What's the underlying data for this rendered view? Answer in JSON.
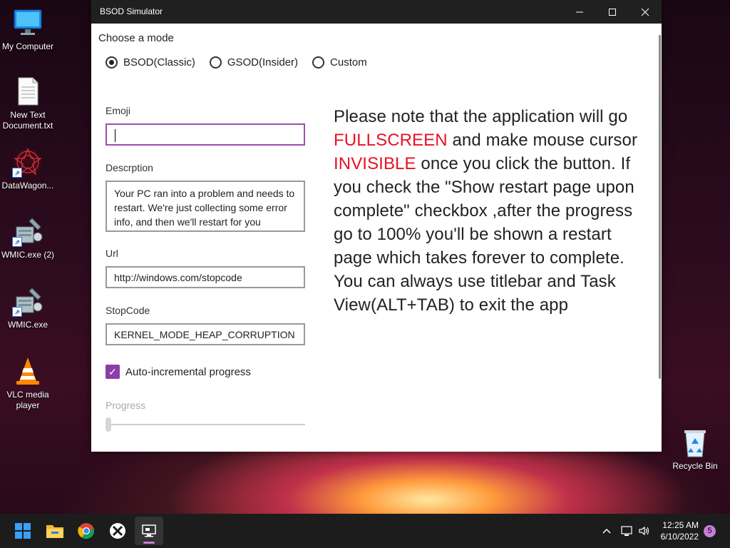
{
  "desktop": {
    "icons": [
      {
        "label": "My Computer"
      },
      {
        "label": "New Text\nDocument.txt"
      },
      {
        "label": "DataWagon..."
      },
      {
        "label": "WMIC.exe (2)"
      },
      {
        "label": "WMIC.exe"
      },
      {
        "label": "VLC media\nplayer"
      },
      {
        "label": "Recycle Bin"
      }
    ]
  },
  "window": {
    "title": "BSOD Simulator",
    "controls": {
      "minimize": "—",
      "maximize": "☐",
      "close": "✕"
    }
  },
  "form": {
    "mode_label": "Choose a mode",
    "modes": [
      {
        "label": "BSOD(Classic)",
        "checked": true
      },
      {
        "label": "GSOD(Insider)",
        "checked": false
      },
      {
        "label": "Custom",
        "checked": false
      }
    ],
    "emoji": {
      "label": "Emoji",
      "value": ""
    },
    "description": {
      "label": "Descrption",
      "value": "Your PC ran into a problem and needs to restart. We're just collecting some error info, and then we'll restart for you"
    },
    "url": {
      "label": "Url",
      "value": "http://windows.com/stopcode"
    },
    "stopcode": {
      "label": "StopCode",
      "value": "KERNEL_MODE_HEAP_CORRUPTION"
    },
    "auto_progress": {
      "label": "Auto-incremental progress",
      "checked": true
    },
    "progress": {
      "label": "Progress",
      "value": 0
    }
  },
  "note": {
    "part1": "Please note that the application will go ",
    "highlight1": "FULLSCREEN",
    "part2": " and make mouse cursor ",
    "highlight2": "INVISIBLE",
    "part3": " once you click the button. If you check the \"Show restart page upon complete\" checkbox ,after the progress go to 100% you'll be shown a restart page which takes forever to complete. You can always use titlebar and Task View(ALT+TAB) to exit the app"
  },
  "taskbar": {
    "apps": [
      {
        "name": "start"
      },
      {
        "name": "file-explorer"
      },
      {
        "name": "chrome"
      },
      {
        "name": "xbox"
      },
      {
        "name": "bsod-simulator",
        "active": true
      }
    ],
    "clock": {
      "time": "12:25 AM",
      "date": "6/10/2022"
    },
    "notification_count": "5"
  },
  "colors": {
    "accent": "#8a3fa8",
    "highlight": "#e81123",
    "titlebar": "#202020",
    "taskbar": "#1c1c1c"
  }
}
